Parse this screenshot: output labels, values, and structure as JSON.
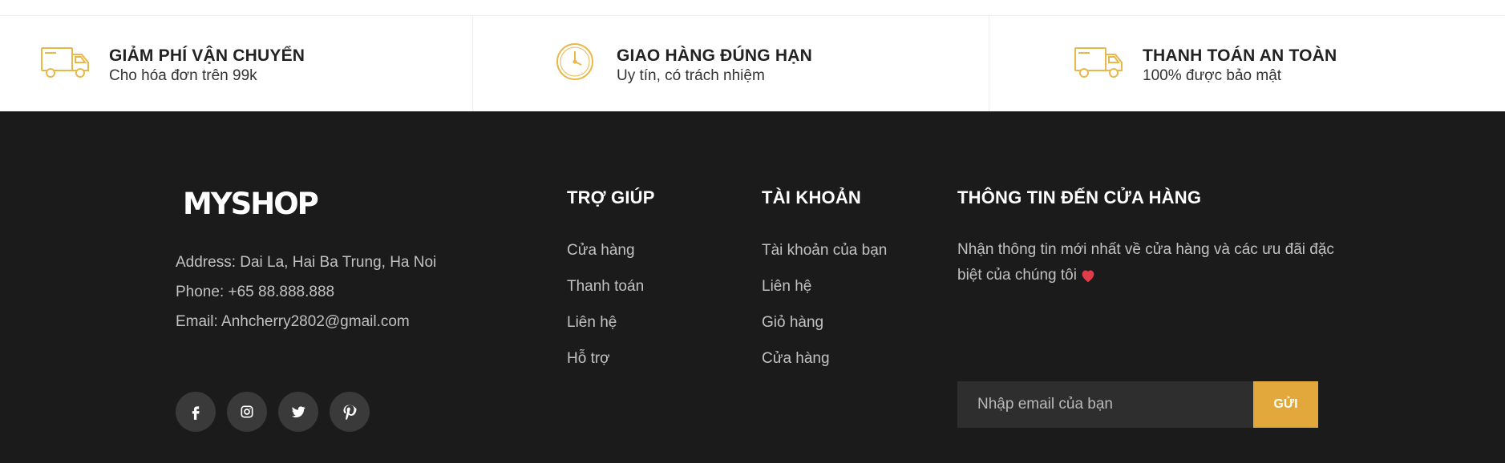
{
  "colors": {
    "accent": "#e3a83c",
    "footer_bg": "#1b1b1b",
    "icon_gold": "#e8b84b"
  },
  "features": [
    {
      "icon": "truck-icon",
      "title": "GIẢM PHÍ VẬN CHUYỂN",
      "subtitle": "Cho hóa đơn trên 99k"
    },
    {
      "icon": "clock-icon",
      "title": "GIAO HÀNG ĐÚNG HẠN",
      "subtitle": "Uy tín, có trách nhiệm"
    },
    {
      "icon": "truck-icon",
      "title": "THANH TOÁN AN TOÀN",
      "subtitle": "100% được bảo mật"
    }
  ],
  "brand": {
    "logo": "MYSHOP",
    "address": "Address: Dai La, Hai Ba Trung, Ha Noi",
    "phone": "Phone: +65 88.888.888",
    "email": "Email: Anhcherry2802@gmail.com"
  },
  "socials": [
    "facebook-icon",
    "instagram-icon",
    "twitter-icon",
    "pinterest-icon"
  ],
  "help": {
    "title": "TRỢ GIÚP",
    "links": [
      "Cửa hàng",
      "Thanh toán",
      "Liên hệ",
      "Hỗ trợ"
    ]
  },
  "account": {
    "title": "TÀI KHOẢN",
    "links": [
      "Tài khoản của bạn",
      "Liên hệ",
      "Giỏ hàng",
      "Cửa hàng"
    ]
  },
  "newsletter": {
    "title": "THÔNG TIN ĐẾN CỬA HÀNG",
    "description": "Nhận thông tin mới nhất về cửa hàng và các ưu đãi đặc biệt của chúng tôi",
    "placeholder": "Nhập email của bạn",
    "button": "GỬI"
  }
}
